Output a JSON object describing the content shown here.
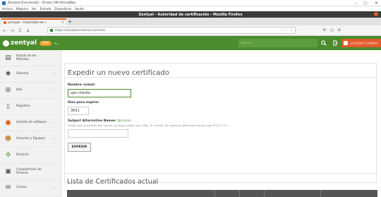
{
  "vbox": {
    "title": "Zentyal [Corriendo] - Oracle VM VirtualBox",
    "menu": [
      "Archivo",
      "Máquina",
      "Ver",
      "Entrada",
      "Dispositivos",
      "Ayuda"
    ],
    "controls": [
      "–",
      "▢",
      "✕"
    ]
  },
  "firefox": {
    "window_title": "Zentyal - Autoridad de certificación - Mozilla Firefox",
    "tab_label": "Zentyal - Autoridad de c",
    "tab_close": "×",
    "new_tab": "+",
    "url": "https://localhost:8443/CA/Index",
    "url_right": "··· ♡ ☆",
    "nav": {
      "back": "←",
      "forward": "→",
      "reload": "C",
      "home": "⌂"
    },
    "toolbar_right": [
      "ⅡⅠ",
      "◫",
      "☰",
      "≡"
    ]
  },
  "header": {
    "logo": "zentyal",
    "edition": "Mali",
    "version": "4.x",
    "search_placeholder": "Buscar...",
    "search_icon": "search-icon",
    "logout_icon": "logout-icon",
    "save_label": "GUARDAR CAMBIOS",
    "colors": {
      "brand": "#4a8c2e",
      "save": "#e35b2b",
      "badge": "#f09e2a"
    }
  },
  "sidebar": {
    "items": [
      {
        "label": "Estado de los Módulos",
        "icon": "modules-icon",
        "arrow": ""
      },
      {
        "label": "Sistema",
        "icon": "gear-icon",
        "arrow": "‹"
      },
      {
        "label": "Red",
        "icon": "network-icon",
        "arrow": "‹"
      },
      {
        "label": "Registros",
        "icon": "document-icon",
        "arrow": ""
      },
      {
        "label": "Gestión de software",
        "icon": "software-icon",
        "arrow": "‹"
      },
      {
        "label": "Usuarios y Equipos",
        "icon": "users-icon",
        "arrow": "‹"
      },
      {
        "label": "Dominio",
        "icon": "domain-icon",
        "arrow": ""
      },
      {
        "label": "Compartición de ficheros",
        "icon": "folder-icon",
        "arrow": ""
      },
      {
        "label": "Correo",
        "icon": "mail-icon",
        "arrow": "‹"
      }
    ]
  },
  "main": {
    "title": "Expedir un nuevo certificado",
    "form": {
      "common_name_label": "Nombre común",
      "common_name_value": "vpn-cliente",
      "days_label": "Días para expirar",
      "days_value": "3651",
      "san_label": "Subject Alternative Names",
      "san_optional": "Opcional",
      "san_hint": "Puede usar separador por comas, los tipos válidos son: DNS, IP y email. Por ejemplo: DNS:host.domain.com,IP:10.2.3.2",
      "san_value": "",
      "submit_label": "EXPEDIR"
    },
    "list_title": "Lista de Certificados actual"
  }
}
